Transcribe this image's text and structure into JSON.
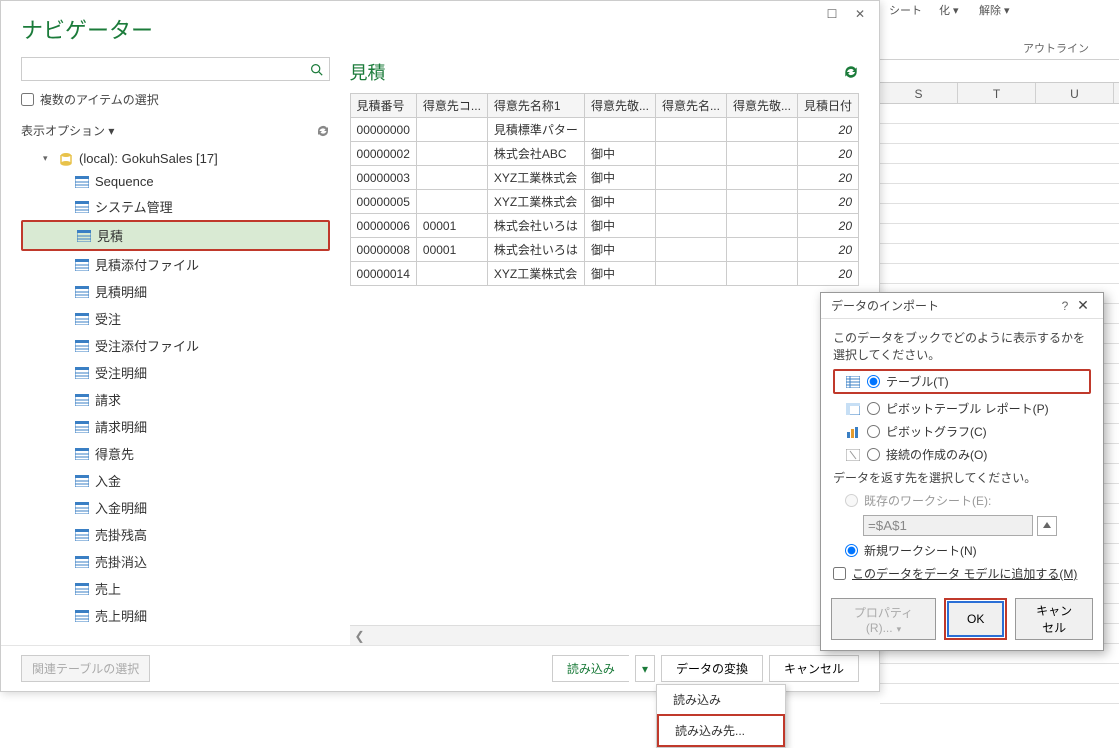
{
  "bg": {
    "section1": "シート",
    "section2": "化 ▾",
    "section3": "解除 ▾",
    "group": "アウトライン",
    "cols": [
      "S",
      "T",
      "U"
    ]
  },
  "navigator": {
    "title": "ナビゲーター",
    "multi_select_label": "複数のアイテムの選択",
    "display_options": "表示オプション ▾",
    "db_label": "(local): GokuhSales [17]",
    "tables": [
      "Sequence",
      "システム管理",
      "見積",
      "見積添付ファイル",
      "見積明細",
      "受注",
      "受注添付ファイル",
      "受注明細",
      "請求",
      "請求明細",
      "得意先",
      "入金",
      "入金明細",
      "売掛残高",
      "売掛消込",
      "売上",
      "売上明細"
    ],
    "selected_table": "見積",
    "preview_title": "見積",
    "columns": [
      "見積番号",
      "得意先コ...",
      "得意先名称1",
      "得意先敬...",
      "得意先名...",
      "得意先敬...",
      "見積日付"
    ],
    "rows": [
      {
        "c0": "00000000",
        "c1": "",
        "c2": "見積標準パター",
        "c3": "",
        "c4": "",
        "c5": "",
        "c6": "20"
      },
      {
        "c0": "00000002",
        "c1": "",
        "c2": "株式会社ABC",
        "c3": "御中",
        "c4": "",
        "c5": "",
        "c6": "20"
      },
      {
        "c0": "00000003",
        "c1": "",
        "c2": "XYZ工業株式会",
        "c3": "御中",
        "c4": "",
        "c5": "",
        "c6": "20"
      },
      {
        "c0": "00000005",
        "c1": "",
        "c2": "XYZ工業株式会",
        "c3": "御中",
        "c4": "",
        "c5": "",
        "c6": "20"
      },
      {
        "c0": "00000006",
        "c1": "00001",
        "c2": "株式会社いろは",
        "c3": "御中",
        "c4": "",
        "c5": "",
        "c6": "20"
      },
      {
        "c0": "00000008",
        "c1": "00001",
        "c2": "株式会社いろは",
        "c3": "御中",
        "c4": "",
        "c5": "",
        "c6": "20"
      },
      {
        "c0": "00000014",
        "c1": "",
        "c2": "XYZ工業株式会",
        "c3": "御中",
        "c4": "",
        "c5": "",
        "c6": "20"
      }
    ],
    "related_tables_btn": "関連テーブルの選択",
    "load_btn": "読み込み",
    "transform_btn": "データの変換",
    "cancel_btn": "キャンセル",
    "menu": {
      "load": "読み込み",
      "load_to": "読み込み先..."
    }
  },
  "import": {
    "title": "データのインポート",
    "prompt1": "このデータをブックでどのように表示するかを選択してください。",
    "opt_table": "テーブル(T)",
    "opt_pivottable": "ピボットテーブル レポート(P)",
    "opt_pivotchart": "ピボットグラフ(C)",
    "opt_conn": "接続の作成のみ(O)",
    "prompt2": "データを返す先を選択してください。",
    "opt_existing": "既存のワークシート(E):",
    "cell_ref": "=$A$1",
    "opt_new": "新規ワークシート(N)",
    "add_model": "このデータをデータ モデルに追加する(M)",
    "properties_btn": "プロパティ(R)...",
    "ok_btn": "OK",
    "cancel_btn": "キャンセル"
  }
}
